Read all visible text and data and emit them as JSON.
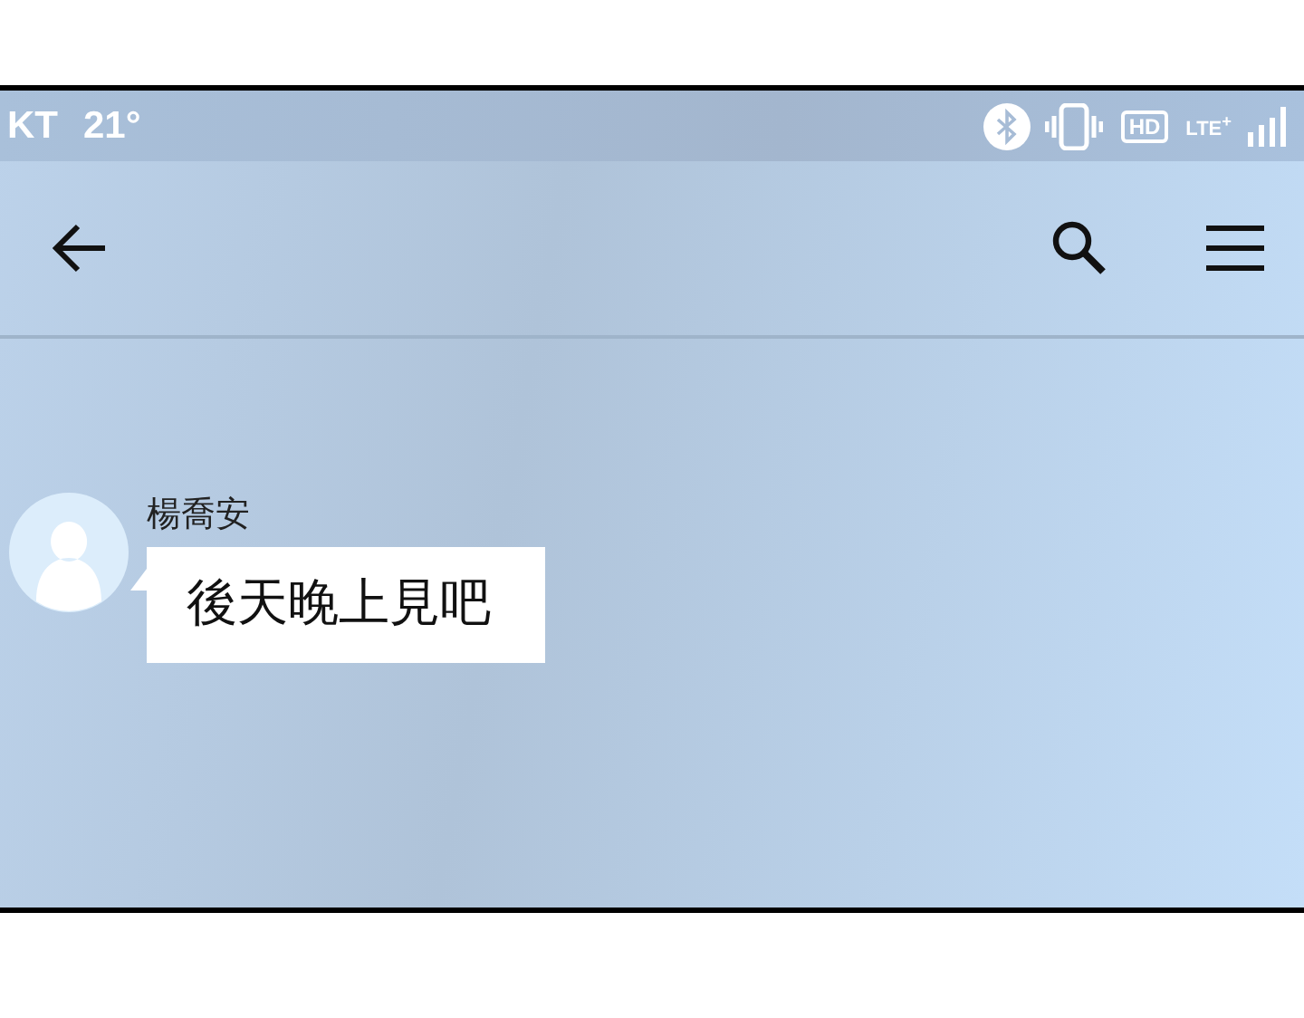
{
  "status_bar": {
    "carrier": "KT",
    "temperature": "21°",
    "hd_label": "HD",
    "network_label": "LTE$^{+}$"
  },
  "messages": [
    {
      "sender": "楊喬安",
      "text": "後天晚上見吧"
    }
  ]
}
